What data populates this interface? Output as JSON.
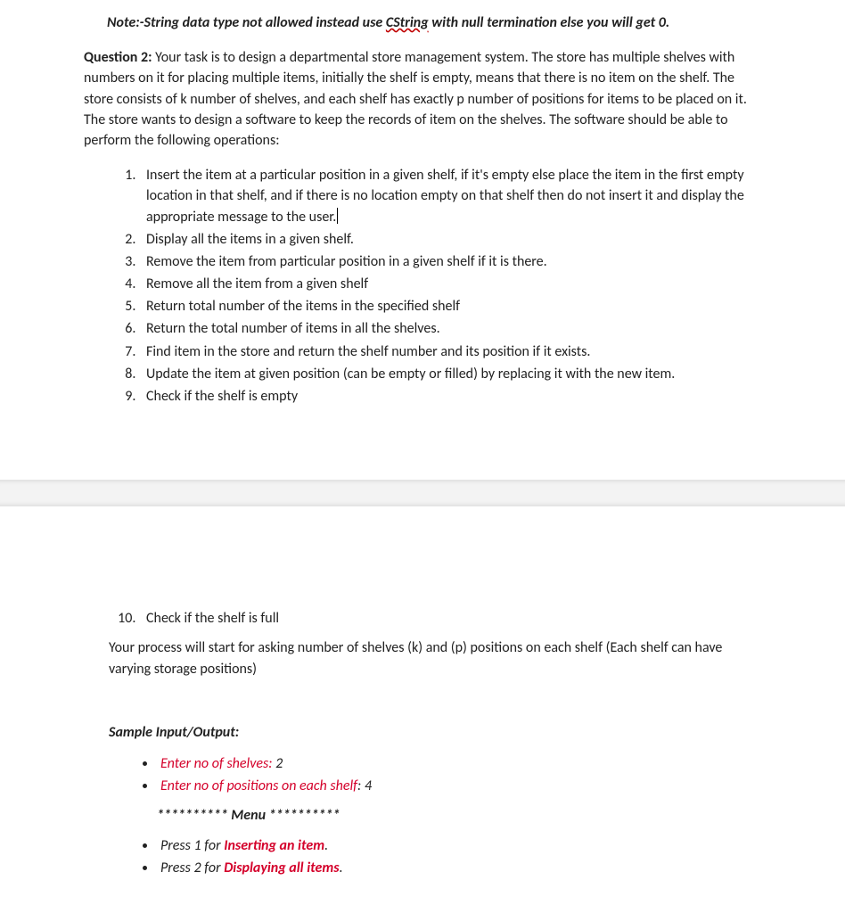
{
  "note": {
    "prefix": "Note:-String data type not allowed instead use ",
    "squiggle_word": "CString",
    "suffix": " with null termination else you will get 0."
  },
  "question": {
    "label": "Question 2:",
    "body": " Your task is to design a departmental store management system. The store has multiple shelves with numbers on it for placing multiple items, initially the shelf is empty, means that there is no item on the shelf. The store consists of k number of shelves, and each shelf has exactly p number of positions for items to be placed on it. The store wants to design a software to keep the records of item on the shelves. The software should be able to perform the following operations:"
  },
  "operations_top": [
    "Insert the item at a particular position in a given shelf, if it's empty else place the item in the first empty location in that shelf, and if there is no location empty on that shelf then do not insert it and display the appropriate message to the user.",
    "Display all the items in a given shelf.",
    "Remove the item from particular position in a given shelf if it is there.",
    "Remove all the item from a given shelf",
    "Return total number of the items in the specified shelf",
    "Return the total number of items in all the shelves.",
    "Find item in the store and return the shelf number and its position if it exists.",
    "Update the item at given position (can be empty or filled) by replacing it with the new item.",
    "Check if the shelf is empty"
  ],
  "operations_continued": [
    "Check if the shelf is full"
  ],
  "process_text": "Your process will start for asking number of shelves (k) and (p) positions on each shelf (Each shelf can have varying storage positions)",
  "sample_heading": "Sample Input/Output:",
  "sample_inputs": [
    {
      "label": "Enter no of shelves:",
      "value": " 2"
    },
    {
      "label": "Enter no of positions on each shelf",
      "suffix": ": 4"
    }
  ],
  "menu_line": "********** Menu **********",
  "menu_items": [
    {
      "prefix": "Press 1 for ",
      "action": "Inserting an item",
      "period": "."
    },
    {
      "prefix": "Press 2 for ",
      "action": "Displaying all items",
      "period": "."
    }
  ]
}
